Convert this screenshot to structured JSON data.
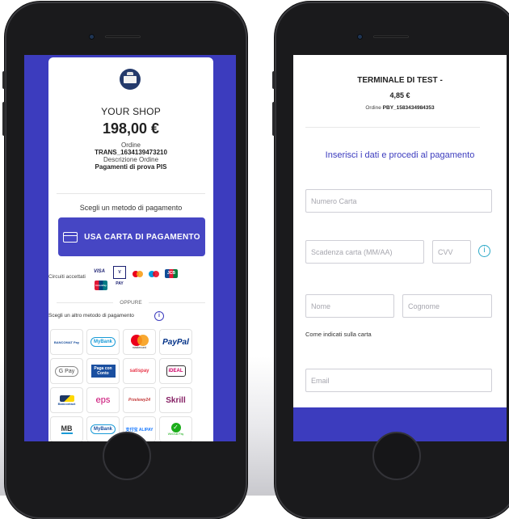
{
  "left": {
    "shop_name": "YOUR SHOP",
    "amount": "198,00 €",
    "order_label": "Ordine",
    "order_id": "TRANS_1634139473210",
    "description_label": "Descrizione Ordine",
    "description_value": "Pagamenti di prova PIS",
    "choose_method": "Scegli un metodo di pagamento",
    "card_button": "USA CARTA DI PAGAMENTO",
    "circuits_label": "Circuiti accettati",
    "circuits": [
      "VISA",
      "V PAY",
      "mastercard",
      "maestro",
      "JCB",
      "UnionPay"
    ],
    "or_label": "OPPURE",
    "other_method": "Scegli un altro metodo di pagamento",
    "methods": [
      "BANCOMAT Pay",
      "MyBank",
      "mastercard",
      "PayPal",
      "G Pay",
      "Paga con Conto",
      "satispay",
      "iDEAL",
      "Bancontact",
      "eps",
      "Przelewy24",
      "Skrill",
      "MB",
      "MyBank",
      "支付宝 ALIPAY",
      "WeChat Pay"
    ]
  },
  "right": {
    "terminal_title": "TERMINALE DI TEST -",
    "amount": "4,85 €",
    "order_prefix": "Ordine",
    "order_id": "PBY_1583434984353",
    "instructions": "Inserisci i dati e procedi al pagamento",
    "card_number_placeholder": "Numero Carta",
    "expiry_placeholder": "Scadenza carta (MM/AA)",
    "cvv_placeholder": "CVV",
    "first_name_placeholder": "Nome",
    "last_name_placeholder": "Cognome",
    "name_note": "Come indicati sulla carta",
    "email_placeholder": "Email"
  },
  "colors": {
    "primary": "#3c3cbe",
    "button": "#4646c4",
    "info": "#2aa8c7"
  }
}
